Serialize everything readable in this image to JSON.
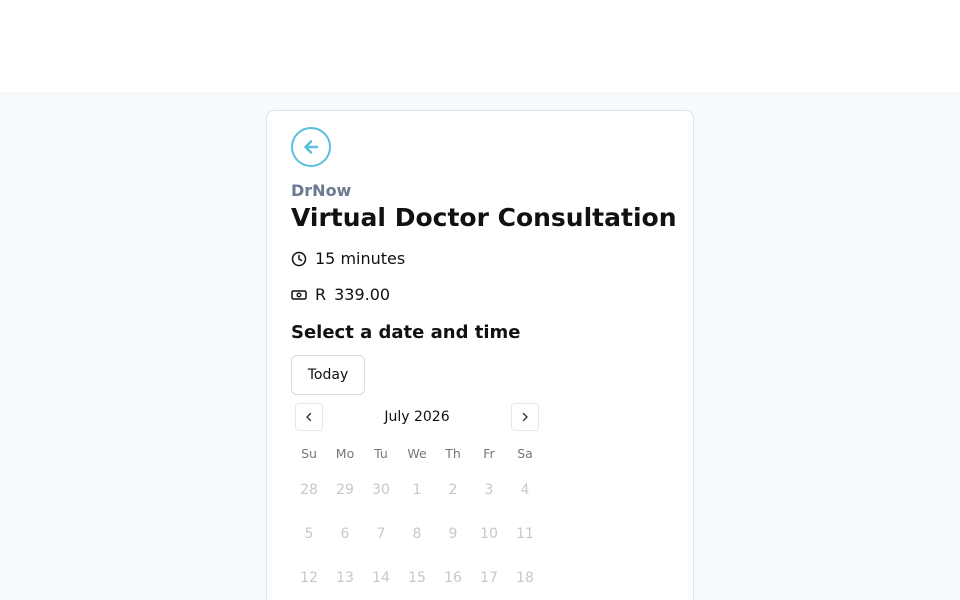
{
  "card": {
    "back_icon": "arrow-left-icon",
    "brand": "DrNow",
    "title": "Virtual Doctor Consultation",
    "duration": "15 minutes",
    "duration_icon": "clock-icon",
    "price_currency": "R",
    "price_amount": "339.00",
    "price_icon": "banknote-icon",
    "accent_color": "#5bc0de"
  },
  "booking": {
    "section_title": "Select a date and time",
    "today_label": "Today"
  },
  "calendar": {
    "month_label": "July 2026",
    "prev_icon": "chevron-left-icon",
    "next_icon": "chevron-right-icon",
    "weekdays": [
      "Su",
      "Mo",
      "Tu",
      "We",
      "Th",
      "Fr",
      "Sa"
    ],
    "weeks": [
      [
        "28",
        "29",
        "30",
        "1",
        "2",
        "3",
        "4"
      ],
      [
        "5",
        "6",
        "7",
        "8",
        "9",
        "10",
        "11"
      ],
      [
        "12",
        "13",
        "14",
        "15",
        "16",
        "17",
        "18"
      ]
    ]
  }
}
